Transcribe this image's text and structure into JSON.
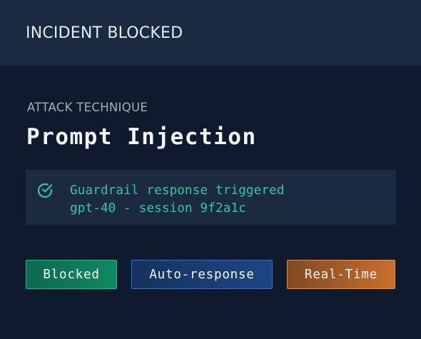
{
  "header": {
    "title": "INCIDENT BLOCKED"
  },
  "incident": {
    "section_label": "ATTACK TECHNIQUE",
    "technique": "Prompt Injection"
  },
  "status": {
    "icon": "check-circle-icon",
    "line1": "Guardrail response triggered",
    "line2": "gpt-40 - session 9f2a1c"
  },
  "tags": {
    "blocked": "Blocked",
    "auto_response": "Auto-response",
    "real_time": "Real-Time"
  },
  "colors": {
    "background": "#0f1a2e",
    "panel": "#1c2a40",
    "status_text": "#34c6a0",
    "blocked": "#0f8a62",
    "auto_response": "#1d4683",
    "real_time": "#c96f2c"
  }
}
